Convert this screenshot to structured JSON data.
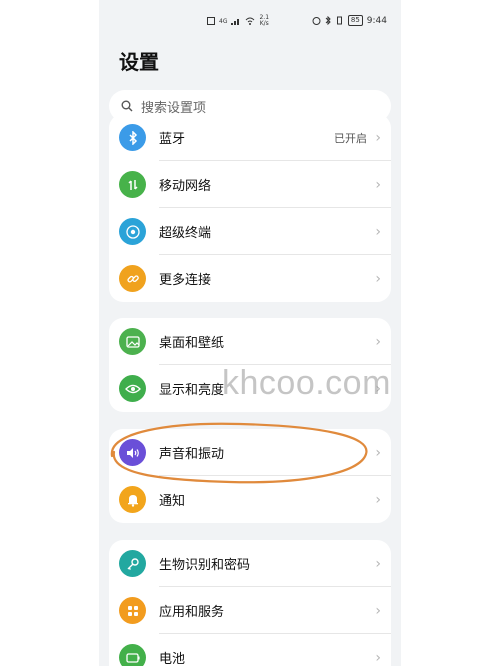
{
  "status_bar": {
    "signal_text": "4G",
    "speed_value": "2.1",
    "speed_unit": "K/s",
    "battery": "85",
    "time": "9:44"
  },
  "page_title": "设置",
  "search": {
    "placeholder": "搜索设置项"
  },
  "groups": [
    {
      "items": [
        {
          "label": "蓝牙",
          "value": "已开启",
          "icon": "bluetooth-icon",
          "color": "#3b9be8"
        },
        {
          "label": "移动网络",
          "icon": "mobile-data-icon",
          "color": "#47b24a"
        },
        {
          "label": "超级终端",
          "icon": "super-device-icon",
          "color": "#2ba3d8"
        },
        {
          "label": "更多连接",
          "icon": "link-icon",
          "color": "#f0a21e"
        }
      ]
    },
    {
      "items": [
        {
          "label": "桌面和壁纸",
          "icon": "wallpaper-icon",
          "color": "#4cb14e"
        },
        {
          "label": "显示和亮度",
          "icon": "eye-icon",
          "color": "#3fae4c"
        }
      ]
    },
    {
      "items": [
        {
          "label": "声音和振动",
          "icon": "speaker-icon",
          "color": "#6a4fd8"
        },
        {
          "label": "通知",
          "icon": "bell-icon",
          "color": "#f2a51c"
        }
      ]
    },
    {
      "items": [
        {
          "label": "生物识别和密码",
          "icon": "key-icon",
          "color": "#22a8a0"
        },
        {
          "label": "应用和服务",
          "icon": "apps-icon",
          "color": "#f29c1f"
        },
        {
          "label": "电池",
          "icon": "battery-icon",
          "color": "#43b04a"
        }
      ]
    }
  ],
  "watermark": "khcoo.com",
  "annotation_color": "#e08a3c"
}
